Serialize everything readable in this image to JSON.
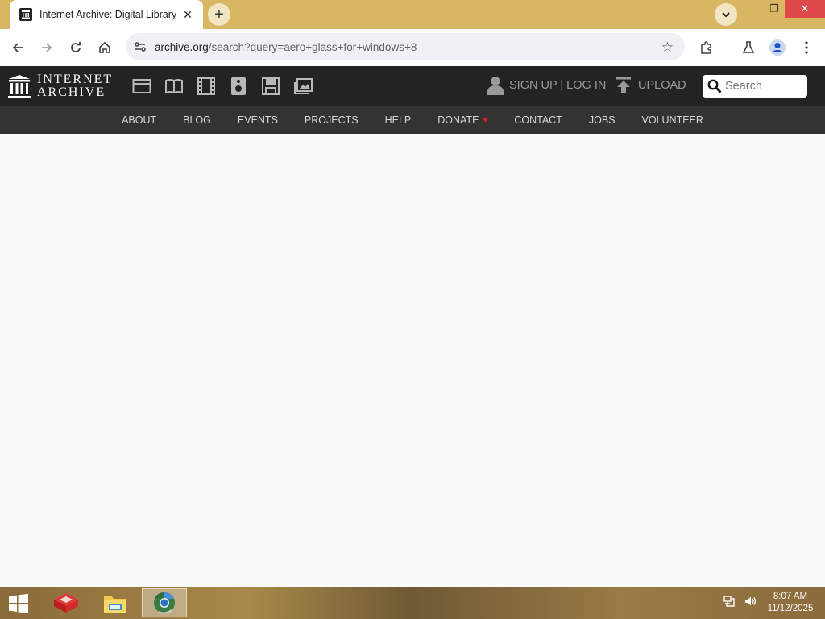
{
  "browser": {
    "tab_title": "Internet Archive: Digital Library",
    "tab_close": "✕",
    "new_tab": "+",
    "url_host": "archive.org",
    "url_rest": "/search?query=aero+glass+for+windows+8",
    "window_controls": {
      "minimize": "—",
      "restore": "❐",
      "close": "✕"
    }
  },
  "ia_header": {
    "logo_line1": "INTERNET",
    "logo_line2": "ARCHIVE",
    "media_icons": [
      "web-icon",
      "texts-icon",
      "video-icon",
      "audio-icon",
      "software-icon",
      "images-icon"
    ],
    "signup_label": "SIGN UP | LOG IN",
    "upload_label": "UPLOAD",
    "search_placeholder": "Search"
  },
  "ia_nav": {
    "items": [
      "ABOUT",
      "BLOG",
      "EVENTS",
      "PROJECTS",
      "HELP",
      "DONATE",
      "CONTACT",
      "JOBS",
      "VOLUNTEER"
    ],
    "donate_heart": "♥"
  },
  "taskbar": {
    "apps": [
      "red-cube-app-icon",
      "file-explorer-icon",
      "chrome-browser-icon"
    ],
    "time": "8:07 AM",
    "date": "11/12/2025"
  },
  "colors": {
    "tabstrip": "#d9b662",
    "ia_header": "#232323",
    "ia_nav": "#333333",
    "donate_heart": "#e21f26",
    "close_button": "#e04a4a"
  }
}
